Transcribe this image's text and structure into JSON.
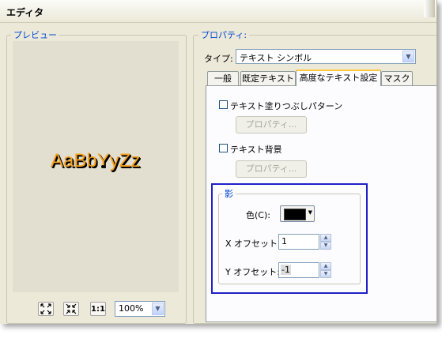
{
  "window": {
    "title": "エディタ"
  },
  "preview": {
    "group_label": "プレビュー",
    "sample_text": "AaBbYyZz",
    "text_color": "#f4a020",
    "shadow_color": "#000000",
    "toolbar": {
      "zoom_in_icon": "zoom-in-icon",
      "zoom_out_icon": "zoom-out-icon",
      "actual_size_label": "1:1",
      "zoom_value": "100%"
    }
  },
  "properties": {
    "group_label": "プロパティ:",
    "type_label": "タイプ:",
    "type_value": "テキスト シンボル",
    "tabs": [
      {
        "label": "一般",
        "active": false
      },
      {
        "label": "既定テキスト",
        "active": false
      },
      {
        "label": "高度なテキスト設定",
        "active": true
      },
      {
        "label": "マスク",
        "active": false
      }
    ],
    "fill_pattern": {
      "label": "テキスト塗りつぶしパターン",
      "checked": false,
      "button": "プロパティ..."
    },
    "background": {
      "label": "テキスト背景",
      "checked": false,
      "button": "プロパティ..."
    },
    "shadow": {
      "group_label": "影",
      "color_label": "色(C):",
      "color_value": "#000000",
      "x_offset_label": "X オフセット:",
      "x_offset_value": "1",
      "y_offset_label": "Y オフセット:",
      "y_offset_value": "-1"
    }
  }
}
